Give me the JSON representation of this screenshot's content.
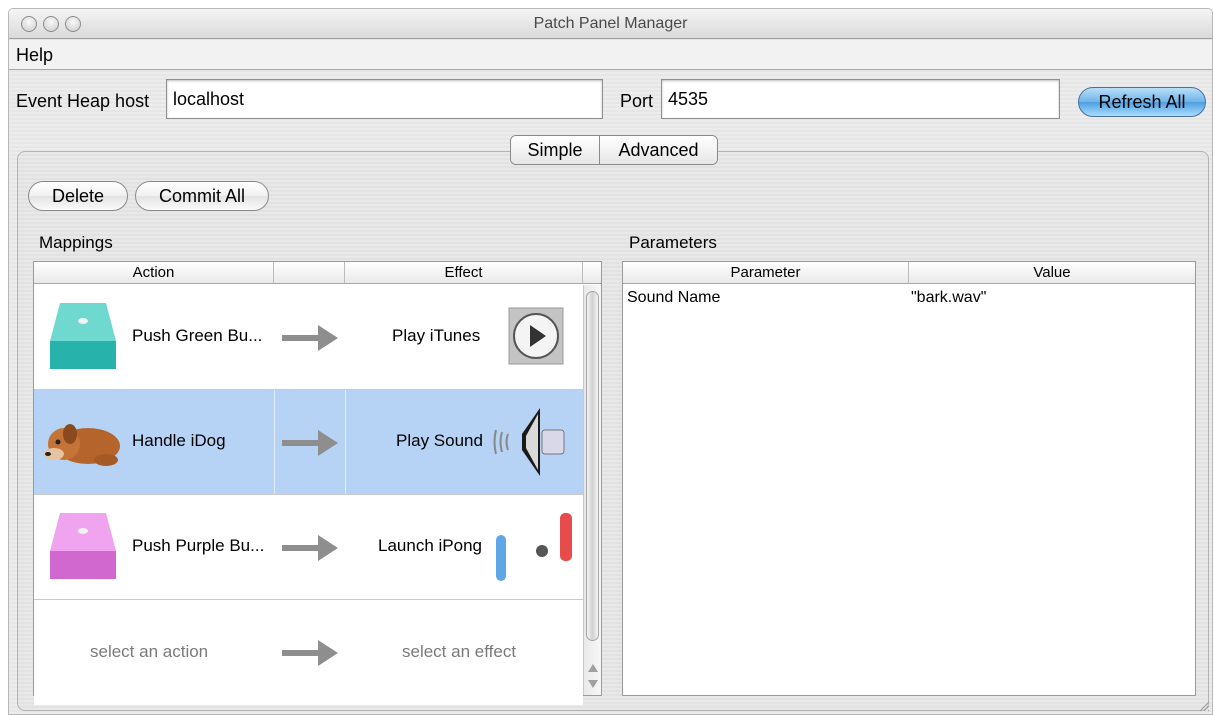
{
  "window": {
    "title": "Patch Panel Manager"
  },
  "menu": {
    "help": "Help"
  },
  "connection": {
    "host_label": "Event Heap host",
    "host_value": "localhost",
    "port_label": "Port",
    "port_value": "4535",
    "refresh_label": "Refresh All"
  },
  "tabs": {
    "simple": "Simple",
    "advanced": "Advanced",
    "selected": "Simple"
  },
  "toolbar": {
    "delete_label": "Delete",
    "commit_label": "Commit All"
  },
  "mappings": {
    "title": "Mappings",
    "columns": {
      "action": "Action",
      "effect": "Effect"
    },
    "rows": [
      {
        "action": "Push Green Bu...",
        "effect": "Play iTunes",
        "action_icon": "green-button-icon",
        "effect_icon": "play-icon"
      },
      {
        "action": "Handle iDog",
        "effect": "Play Sound",
        "action_icon": "idog-icon",
        "effect_icon": "speaker-icon",
        "selected": true
      },
      {
        "action": "Push Purple Bu...",
        "effect": "Launch iPong",
        "action_icon": "purple-button-icon",
        "effect_icon": "pong-icon"
      },
      {
        "action": "select an action",
        "effect": "select an effect",
        "placeholder": true
      }
    ]
  },
  "parameters": {
    "title": "Parameters",
    "columns": {
      "parameter": "Parameter",
      "value": "Value"
    },
    "rows": [
      {
        "parameter": "Sound Name",
        "value": "\"bark.wav\""
      }
    ]
  },
  "colors": {
    "selection": "#b6d3f5",
    "accent": "#6fb4ea"
  }
}
